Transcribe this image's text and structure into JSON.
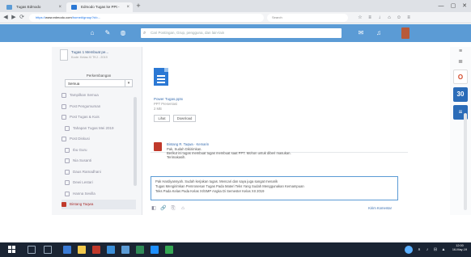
{
  "browser": {
    "tabs": [
      {
        "label": "Tugas Edmodo",
        "active": false
      },
      {
        "label": "Edmodo Tugas ke PPt -",
        "active": true
      }
    ],
    "new_tab": "+",
    "window_controls": [
      "—",
      "▢",
      "✕"
    ],
    "url_scheme": "https://",
    "url_host": "www.edmodo.com",
    "url_path": "/home#/group?id=...",
    "url_search_placeholder": "Search",
    "nav": [
      "◀",
      "▶",
      "⟳"
    ]
  },
  "app_header": {
    "search_placeholder": "Cari Postingan, Grup, pengguna, dan lain-lain"
  },
  "sidebar": {
    "course_title": "Tugas 1 Membuat pe...",
    "course_sub": "Kode: Kelas XI TKJ - 2019",
    "filter_label": "Perkembangan",
    "filter_value": "Semua",
    "items": [
      {
        "label": "Tampilkan Semua",
        "sub": false,
        "active": false
      },
      {
        "label": "Post Pengumuman",
        "sub": false,
        "active": false
      },
      {
        "label": "Post Tugas & Kuis",
        "sub": false,
        "active": false
      },
      {
        "label": "Tahapan Tugas Mei 2019",
        "sub": true,
        "active": false
      },
      {
        "label": "Post Diskusi",
        "sub": false,
        "active": false
      },
      {
        "label": "Ibu Guru",
        "sub": true,
        "active": false
      },
      {
        "label": "Nia Susanti",
        "sub": true,
        "active": false
      },
      {
        "label": "Daus Ramadhani",
        "sub": true,
        "active": false
      },
      {
        "label": "Dewi Lestari",
        "sub": true,
        "active": false
      },
      {
        "label": "Hanna Sevilla",
        "sub": true,
        "active": false
      },
      {
        "label": "Bintang Taqwa",
        "sub": false,
        "active": true
      }
    ]
  },
  "file": {
    "name": "Power Tugas.pptx",
    "type": "PPT Presentasi",
    "size": "2 MB",
    "view_label": "Lihat",
    "download_label": "Download"
  },
  "comment": {
    "author": "Bintang R. Taqwa · Kemarin",
    "lines": [
      "Pak, Sudah Dikirimkan.",
      "Berikut ini tugas membuat tugas membuat saat PPT. Mohon untuk diberi masukan.",
      "Terimakasih."
    ]
  },
  "composer": {
    "lines": [
      "Pak Hardiyansyah. Sudah kerjakan tugas. Mencari dan saya juga sangat menarik",
      "Tugas Mengirimkan Pemrosesan Tugas Pada Materi Teks Yang Sudah Menggunakan Kemampuan",
      "Teks Pada Kelas Pada Kelas XI/SMP Angka Di Semester Kelas XII 2019"
    ],
    "tools": [
      "◧",
      "🔗",
      "⎘",
      "⌂"
    ],
    "send_label": "Kirim Komentar"
  },
  "rail": {
    "top_icons": [
      "≡",
      "≣"
    ],
    "apps": [
      {
        "label": "O",
        "color": "#d24726",
        "bg": "#ffffff"
      },
      {
        "label": "30",
        "color": "#ffffff",
        "bg": "#2b6cb8"
      },
      {
        "label": "≡",
        "color": "#ffffff",
        "bg": "#2b6cb8"
      }
    ]
  },
  "taskbar": {
    "time": "12:00",
    "date": "16-May-19",
    "tray": [
      "∧",
      "♪",
      "⊟",
      "▲"
    ]
  }
}
